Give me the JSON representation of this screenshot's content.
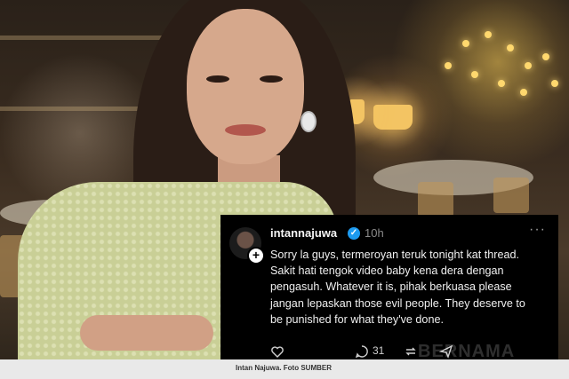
{
  "post": {
    "username": "intannajuwa",
    "time": "10h",
    "more": "···",
    "lines": [
      "Sorry la guys, termeroyan teruk tonight kat thread.",
      "Sakit hati tengok video baby kena dera dengan",
      "pengasuh. Whatever it is, pihak berkuasa please",
      "jangan lepaskan those evil people. They deserve to",
      "be punished for what they've done."
    ],
    "reply_count": "31",
    "verified_glyph": "✓",
    "follow_glyph": "+"
  },
  "caption": "Intan Najuwa. Foto SUMBER",
  "watermark": "BERNAMA",
  "colors": {
    "verified": "#1d9bf0",
    "card_bg": "#000000",
    "caption_bg": "#e9e9e9"
  }
}
